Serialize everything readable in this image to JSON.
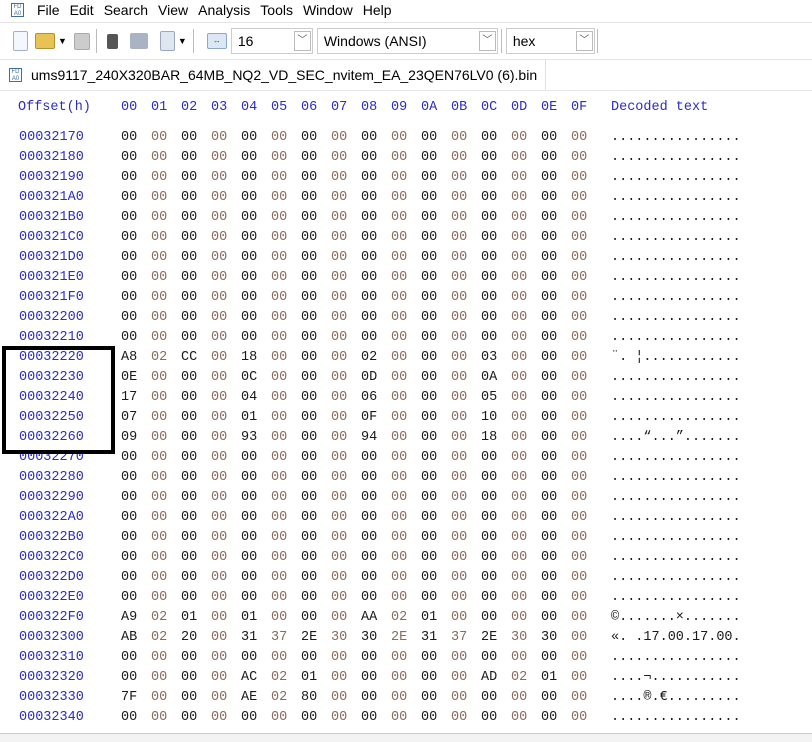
{
  "menu": [
    "File",
    "Edit",
    "Search",
    "View",
    "Analysis",
    "Tools",
    "Window",
    "Help"
  ],
  "toolbar": {
    "bytes_per_row": "16",
    "charset": "Windows (ANSI)",
    "offset_base": "hex"
  },
  "tab": {
    "filename": "ums9117_240X320BAR_64MB_NQ2_VD_SEC_nvitem_EA_23QEN76LV0 (6).bin"
  },
  "header": {
    "offset": "Offset(h)",
    "columns": [
      "00",
      "01",
      "02",
      "03",
      "04",
      "05",
      "06",
      "07",
      "08",
      "09",
      "0A",
      "0B",
      "0C",
      "0D",
      "0E",
      "0F"
    ],
    "decoded": "Decoded text"
  },
  "colors": {
    "offset": "#2b2bd1",
    "byte_even": "#1a1a1a",
    "byte_odd": "#8a6b5c",
    "highlight_box": "#000000"
  },
  "highlighted_offsets": [
    "00032220",
    "00032230",
    "00032240",
    "00032250",
    "00032260"
  ],
  "rows": [
    {
      "offset": "00032170",
      "bytes": "00 00 00 00 00 00 00 00 00 00 00 00 00 00 00 00",
      "text": "................"
    },
    {
      "offset": "00032180",
      "bytes": "00 00 00 00 00 00 00 00 00 00 00 00 00 00 00 00",
      "text": "................"
    },
    {
      "offset": "00032190",
      "bytes": "00 00 00 00 00 00 00 00 00 00 00 00 00 00 00 00",
      "text": "................"
    },
    {
      "offset": "000321A0",
      "bytes": "00 00 00 00 00 00 00 00 00 00 00 00 00 00 00 00",
      "text": "................"
    },
    {
      "offset": "000321B0",
      "bytes": "00 00 00 00 00 00 00 00 00 00 00 00 00 00 00 00",
      "text": "................"
    },
    {
      "offset": "000321C0",
      "bytes": "00 00 00 00 00 00 00 00 00 00 00 00 00 00 00 00",
      "text": "................"
    },
    {
      "offset": "000321D0",
      "bytes": "00 00 00 00 00 00 00 00 00 00 00 00 00 00 00 00",
      "text": "................"
    },
    {
      "offset": "000321E0",
      "bytes": "00 00 00 00 00 00 00 00 00 00 00 00 00 00 00 00",
      "text": "................"
    },
    {
      "offset": "000321F0",
      "bytes": "00 00 00 00 00 00 00 00 00 00 00 00 00 00 00 00",
      "text": "................"
    },
    {
      "offset": "00032200",
      "bytes": "00 00 00 00 00 00 00 00 00 00 00 00 00 00 00 00",
      "text": "................"
    },
    {
      "offset": "00032210",
      "bytes": "00 00 00 00 00 00 00 00 00 00 00 00 00 00 00 00",
      "text": "................"
    },
    {
      "offset": "00032220",
      "bytes": "A8 02 CC 00 18 00 00 00 02 00 00 00 03 00 00 00",
      "text": "¨. ¦............"
    },
    {
      "offset": "00032230",
      "bytes": "0E 00 00 00 0C 00 00 00 0D 00 00 00 0A 00 00 00",
      "text": "................"
    },
    {
      "offset": "00032240",
      "bytes": "17 00 00 00 04 00 00 00 06 00 00 00 05 00 00 00",
      "text": "................"
    },
    {
      "offset": "00032250",
      "bytes": "07 00 00 00 01 00 00 00 0F 00 00 00 10 00 00 00",
      "text": "................"
    },
    {
      "offset": "00032260",
      "bytes": "09 00 00 00 93 00 00 00 94 00 00 00 18 00 00 00",
      "text": "....“...”......."
    },
    {
      "offset": "00032270",
      "bytes": "00 00 00 00 00 00 00 00 00 00 00 00 00 00 00 00",
      "text": "................"
    },
    {
      "offset": "00032280",
      "bytes": "00 00 00 00 00 00 00 00 00 00 00 00 00 00 00 00",
      "text": "................"
    },
    {
      "offset": "00032290",
      "bytes": "00 00 00 00 00 00 00 00 00 00 00 00 00 00 00 00",
      "text": "................"
    },
    {
      "offset": "000322A0",
      "bytes": "00 00 00 00 00 00 00 00 00 00 00 00 00 00 00 00",
      "text": "................"
    },
    {
      "offset": "000322B0",
      "bytes": "00 00 00 00 00 00 00 00 00 00 00 00 00 00 00 00",
      "text": "................"
    },
    {
      "offset": "000322C0",
      "bytes": "00 00 00 00 00 00 00 00 00 00 00 00 00 00 00 00",
      "text": "................"
    },
    {
      "offset": "000322D0",
      "bytes": "00 00 00 00 00 00 00 00 00 00 00 00 00 00 00 00",
      "text": "................"
    },
    {
      "offset": "000322E0",
      "bytes": "00 00 00 00 00 00 00 00 00 00 00 00 00 00 00 00",
      "text": "................"
    },
    {
      "offset": "000322F0",
      "bytes": "A9 02 01 00 01 00 00 00 AA 02 01 00 00 00 00 00",
      "text": "©.......×......."
    },
    {
      "offset": "00032300",
      "bytes": "AB 02 20 00 31 37 2E 30 30 2E 31 37 2E 30 30 00",
      "text": "«. .17.00.17.00."
    },
    {
      "offset": "00032310",
      "bytes": "00 00 00 00 00 00 00 00 00 00 00 00 00 00 00 00",
      "text": "................"
    },
    {
      "offset": "00032320",
      "bytes": "00 00 00 00 AC 02 01 00 00 00 00 00 AD 02 01 00",
      "text": "....¬..........."
    },
    {
      "offset": "00032330",
      "bytes": "7F 00 00 00 AE 02 80 00 00 00 00 00 00 00 00 00",
      "text": "....®.€........."
    },
    {
      "offset": "00032340",
      "bytes": "00 00 00 00 00 00 00 00 00 00 00 00 00 00 00 00",
      "text": "................"
    }
  ]
}
